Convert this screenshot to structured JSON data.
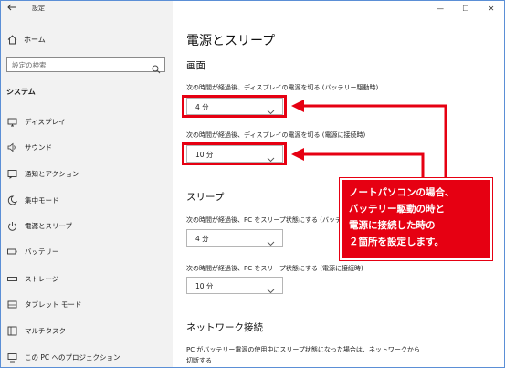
{
  "window": {
    "title": "設定",
    "controls": [
      "—",
      "☐",
      "✕"
    ]
  },
  "sidebar": {
    "home_label": "ホーム",
    "search_placeholder": "設定の検索",
    "section_label": "システム",
    "items": [
      {
        "label": "ディスプレイ",
        "icon": "display-icon"
      },
      {
        "label": "サウンド",
        "icon": "speaker-icon"
      },
      {
        "label": "通知とアクション",
        "icon": "notification-icon"
      },
      {
        "label": "集中モード",
        "icon": "moon-icon"
      },
      {
        "label": "電源とスリープ",
        "icon": "power-icon"
      },
      {
        "label": "バッテリー",
        "icon": "battery-icon"
      },
      {
        "label": "ストレージ",
        "icon": "storage-icon"
      },
      {
        "label": "タブレット モード",
        "icon": "tablet-icon"
      },
      {
        "label": "マルチタスク",
        "icon": "multitask-icon"
      },
      {
        "label": "この PC へのプロジェクション",
        "icon": "projection-icon"
      }
    ]
  },
  "main": {
    "page_title": "電源とスリープ",
    "screen": {
      "heading": "画面",
      "battery_label": "次の時間が経過後、ディスプレイの電源を切る (バッテリー駆動時)",
      "battery_value": "4 分",
      "plugged_label": "次の時間が経過後、ディスプレイの電源を切る (電源に接続時)",
      "plugged_value": "10 分"
    },
    "sleep": {
      "heading": "スリープ",
      "battery_label": "次の時間が経過後、PC をスリープ状態にする (バッテリー駆動時)",
      "battery_value": "4 分",
      "plugged_label": "次の時間が経過後、PC をスリープ状態にする (電源に接続時)",
      "plugged_value": "10 分"
    },
    "network": {
      "heading": "ネットワーク接続",
      "desc_line1": "PC がバッテリー電源の使用中にスリープ状態になった場合は、ネットワークから",
      "desc_line2": "切断する"
    }
  },
  "callout": {
    "lines": [
      "ノートパソコンの場合、",
      "バッテリー駆動の時と",
      "電源に接続した時の",
      "２箇所を設定します。"
    ],
    "color": "#e60012"
  }
}
